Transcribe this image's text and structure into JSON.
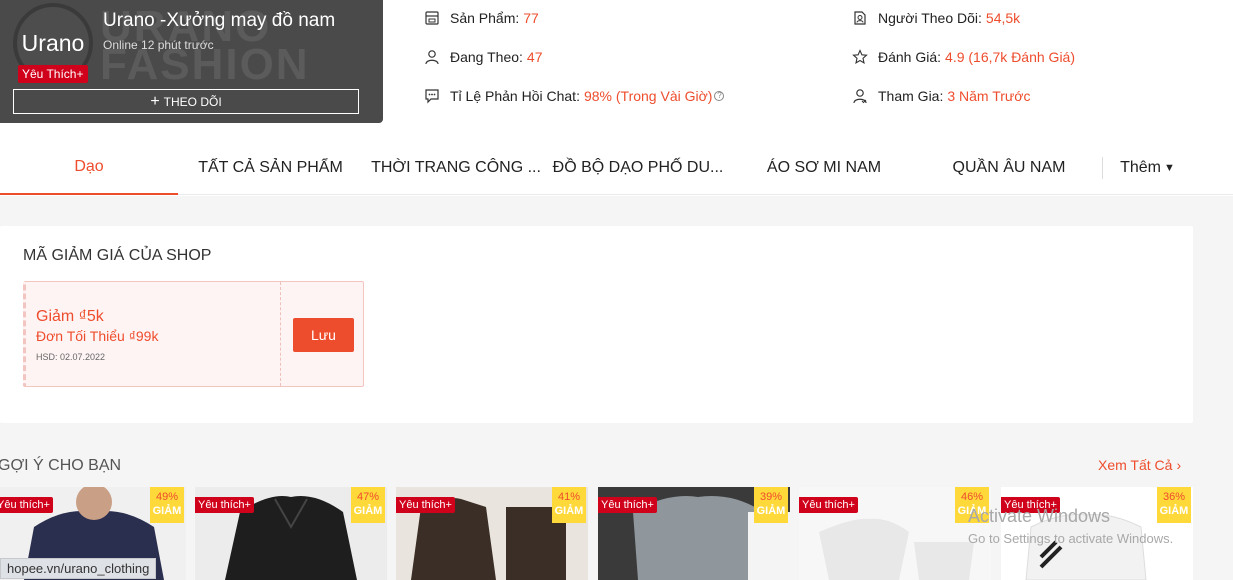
{
  "shop": {
    "avatar_text": "Urano",
    "banner_text_1": "URANO",
    "banner_text_2": "FASHION",
    "name": "Urano -Xưởng may đồ nam",
    "online": "Online 12 phút trước",
    "preferred_badge": "Yêu Thích+",
    "follow_label": "THEO DÕI"
  },
  "stats": {
    "products_label": "Sản Phẩm:",
    "products_value": "77",
    "following_label": "Đang Theo:",
    "following_value": "47",
    "chat_label": "Tỉ Lệ Phản Hồi Chat:",
    "chat_value": "98% (Trong Vài Giờ)",
    "followers_label": "Người Theo Dõi:",
    "followers_value": "54,5k",
    "rating_label": "Đánh Giá:",
    "rating_value": "4.9 (16,7k Đánh Giá)",
    "joined_label": "Tham Gia:",
    "joined_value": "3 Năm Trước"
  },
  "nav": {
    "items": [
      "Dạo",
      "TẤT CẢ SẢN PHẨM",
      "THỜI TRANG CÔNG ...",
      "ĐỒ BỘ DẠO PHỐ DU...",
      "ÁO SƠ MI NAM",
      "QUẦN ÂU NAM"
    ],
    "more": "Thêm"
  },
  "voucher_section": {
    "title": "MÃ GIẢM GIÁ CỦA SHOP",
    "voucher": {
      "title": "Giảm ₫5k",
      "min_order": "Đơn Tối Thiểu ₫99k",
      "expiry": "HSD: 02.07.2022",
      "button": "Lưu"
    }
  },
  "recommend": {
    "title": "GỢI Ý CHO BẠN",
    "see_all": "Xem Tất Cả",
    "tag": "Yêu thích+",
    "discount_label": "GIẢM",
    "products": [
      {
        "discount": "49%",
        "bg": "#2b2f4f"
      },
      {
        "discount": "47%",
        "bg": "#1e1e1e"
      },
      {
        "discount": "41%",
        "bg": "#3a2e26"
      },
      {
        "discount": "39%",
        "bg": "#8f969c"
      },
      {
        "discount": "46%",
        "bg": "#e8e8e8"
      },
      {
        "discount": "36%",
        "bg": "#f2f2f2"
      }
    ]
  },
  "browser": {
    "status_url": "hopee.vn/urano_clothing",
    "watermark_title": "Activate Windows",
    "watermark_sub": "Go to Settings to activate Windows."
  },
  "colors": {
    "accent": "#ee4d2d",
    "badge": "#d0011b",
    "discount_bg": "#ffd839"
  }
}
